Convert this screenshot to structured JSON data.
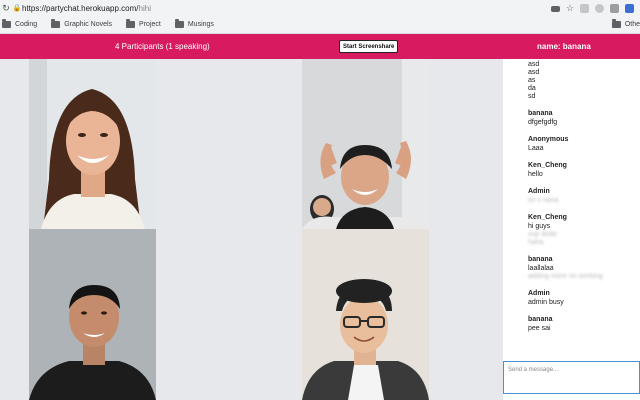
{
  "browser": {
    "url_host": "https://partychat.herokuapp.com/",
    "url_path": "hihi",
    "bookmarks": [
      "Coding",
      "Graphic Novels",
      "Project",
      "Musings"
    ],
    "other": "Othe"
  },
  "header": {
    "participants": "4 Participants (1 speaking)",
    "screenshare_button": "Start Screenshare",
    "name_label": "name: banana"
  },
  "chat": {
    "messages": [
      {
        "sender": "",
        "lines": [
          "asd",
          "asd",
          "as",
          "da",
          "sd"
        ],
        "blurred": false
      },
      {
        "sender": "banana",
        "lines": [
          "dfgefgdfg"
        ],
        "blurred": false
      },
      {
        "sender": "Anonymous",
        "lines": [
          "Laaa"
        ],
        "blurred": false
      },
      {
        "sender": "Ken_Cheng",
        "lines": [
          "hello"
        ],
        "blurred": false
      },
      {
        "sender": "Admin",
        "lines": [
          "lol u nana"
        ],
        "blurred": true
      },
      {
        "sender": "Ken_Cheng",
        "lines": [
          "hi guys"
        ],
        "extra": [
          "sup dude",
          "haha"
        ],
        "blurred": false
      },
      {
        "sender": "banana",
        "lines": [
          "laallalaa"
        ],
        "extra": [
          "adding more on working"
        ],
        "blurred": false
      },
      {
        "sender": "Admin",
        "lines": [
          "admin busy"
        ],
        "blurred": false
      },
      {
        "sender": "banana",
        "lines": [
          "pee sai"
        ],
        "blurred": false
      }
    ],
    "input_placeholder": "Send a message..."
  },
  "colors": {
    "accent": "#d81b60",
    "stage": "#e6e8eb"
  }
}
